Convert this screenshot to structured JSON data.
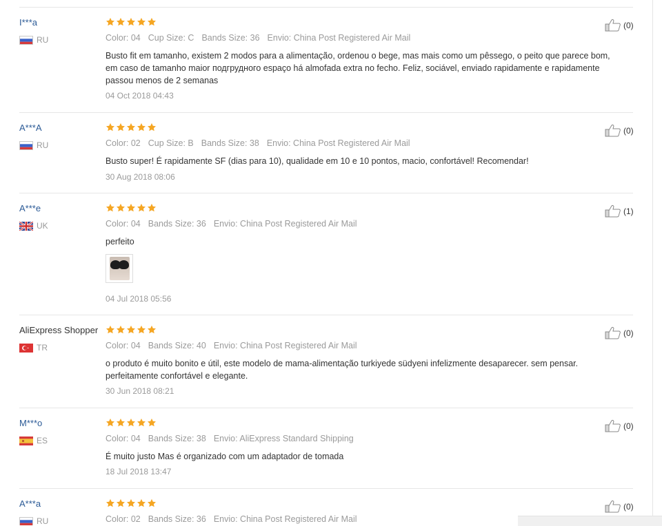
{
  "reviews": [
    {
      "user": "I***a",
      "country": "RU",
      "flag": "ru-flag",
      "rating": 5,
      "meta": [
        "Color: 04",
        "Cup Size: C",
        "Bands Size: 36",
        "Envio: China Post Registered Air Mail"
      ],
      "text": "Busto fit em tamanho, existem 2 modos para a alimentação, ordenou o bege, mas mais como um pêssego, o peito que parece bom, em caso de tamanho maior подгрудного espaço há almofada extra no fecho. Feliz, sociável, enviado rapidamente e rapidamente passou menos de 2 semanas",
      "date": "04 Oct 2018 04:43",
      "helpful": "(0)"
    },
    {
      "user": "A***A",
      "country": "RU",
      "flag": "ru-flag",
      "rating": 5,
      "meta": [
        "Color: 02",
        "Cup Size: B",
        "Bands Size: 38",
        "Envio: China Post Registered Air Mail"
      ],
      "text": "Busto super! É rapidamente SF (dias para 10), qualidade em 10 e 10 pontos, macio, confortável! Recomendar!",
      "date": "30 Aug 2018 08:06",
      "helpful": "(0)"
    },
    {
      "user": "A***e",
      "country": "UK",
      "flag": "uk-flag",
      "rating": 5,
      "meta": [
        "Color: 04",
        "Bands Size: 36",
        "Envio: China Post Registered Air Mail"
      ],
      "text": "perfeito",
      "date": "04 Jul 2018 05:56",
      "helpful": "(1)"
    },
    {
      "user": "AliExpress Shopper",
      "country": "TR",
      "flag": "tr-flag",
      "rating": 5,
      "meta": [
        "Color: 04",
        "Bands Size: 40",
        "Envio: China Post Registered Air Mail"
      ],
      "text": "o produto é muito bonito e útil, este modelo de mama-alimentação turkiyede südyeni infelizmente desaparecer. sem pensar. perfeitamente confortável e elegante.",
      "date": "30 Jun 2018 08:21",
      "helpful": "(0)"
    },
    {
      "user": "M***o",
      "country": "ES",
      "flag": "es-flag",
      "rating": 5,
      "meta": [
        "Color: 04",
        "Bands Size: 38",
        "Envio: AliExpress Standard Shipping"
      ],
      "text": "É muito justo Mas é organizado com um adaptador de tomada",
      "date": "18 Jul 2018 13:47",
      "helpful": "(0)"
    },
    {
      "user": "A***a",
      "country": "RU",
      "flag": "ru-flag",
      "rating": 5,
      "meta": [
        "Color: 02",
        "Bands Size: 36",
        "Envio: China Post Registered Air Mail"
      ],
      "helpful": "(0)"
    }
  ],
  "colors": {
    "star": "#f5a623",
    "username": "#2b5a96",
    "meta": "#9a9a9a",
    "divider": "#e6e6e6"
  },
  "icons": {
    "star": "star-icon",
    "helpful": "thumbs-up-icon",
    "review_photo": "review-photo-thumbnail"
  }
}
